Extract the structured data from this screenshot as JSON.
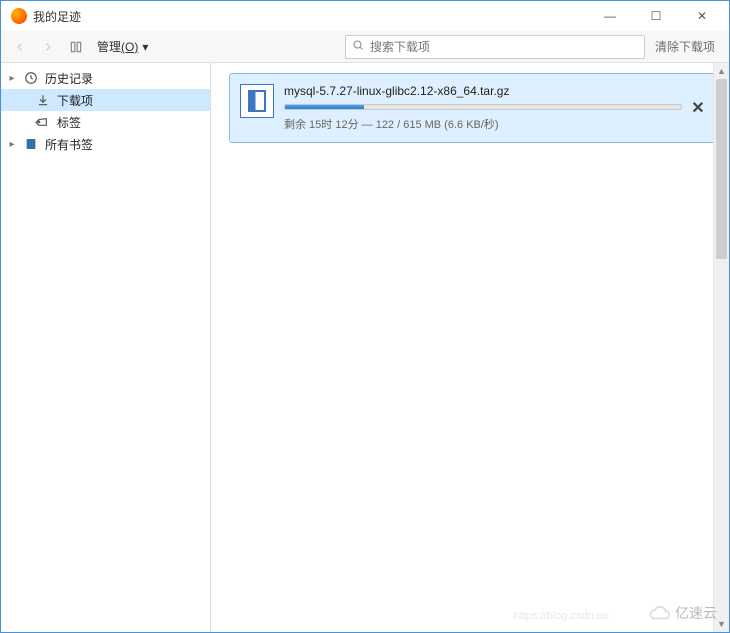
{
  "window": {
    "title": "我的足迹",
    "buttons": {
      "min": "—",
      "max": "☐",
      "close": "✕"
    }
  },
  "toolbar": {
    "back_label": "后退",
    "forward_label": "前进",
    "organize_label_pre": "管理",
    "organize_label_u": "(O)",
    "organize_dropdown": "▾",
    "search_placeholder": "搜索下载项",
    "clear_label": "清除下载项"
  },
  "sidebar": {
    "items": [
      {
        "label": "历史记录",
        "icon": "clock",
        "expandable": true
      },
      {
        "label": "下载项",
        "icon": "download",
        "selected": true,
        "child": true
      },
      {
        "label": "标签",
        "icon": "tag",
        "child": true
      },
      {
        "label": "所有书签",
        "icon": "bookmark",
        "expandable": true
      }
    ]
  },
  "download": {
    "filename": "mysql-5.7.27-linux-glibc2.12-x86_64.tar.gz",
    "status": "剩余 15时 12分 — 122 / 615 MB (6.6 KB/秒)",
    "progress_percent": 20,
    "cancel": "✕"
  },
  "watermark": {
    "text": "亿速云",
    "url_hint": "https://blog.csdn.ne"
  }
}
